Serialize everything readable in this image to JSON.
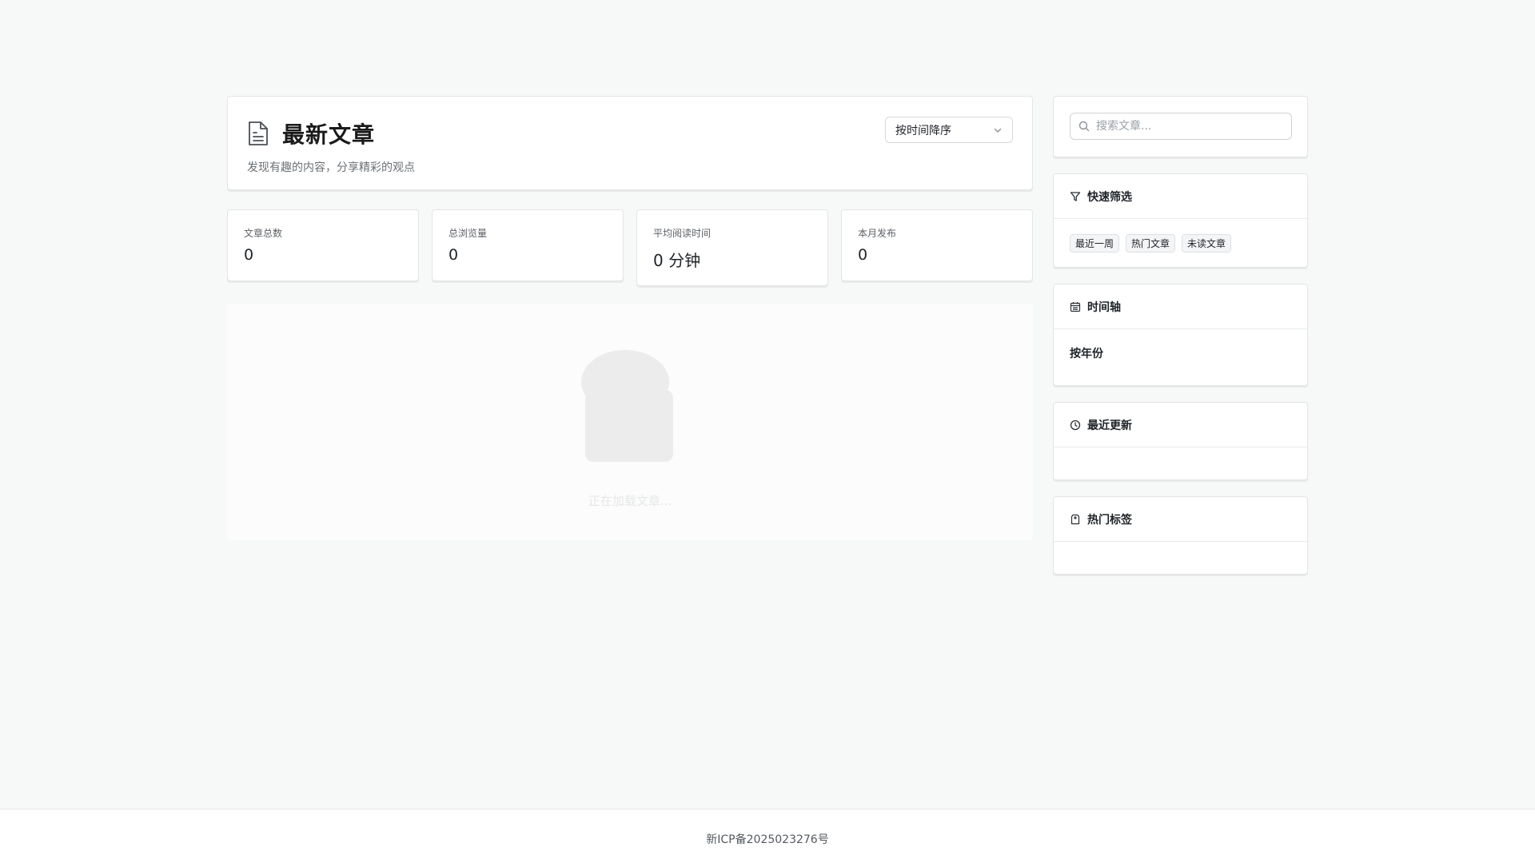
{
  "header": {
    "title": "最新文章",
    "subtitle": "发现有趣的内容，分享精彩的观点",
    "sort_selected": "按时间降序"
  },
  "stats": [
    {
      "label": "文章总数",
      "value": "0"
    },
    {
      "label": "总浏览量",
      "value": "0"
    },
    {
      "label": "平均阅读时间",
      "value": "0 分钟"
    },
    {
      "label": "本月发布",
      "value": "0"
    }
  ],
  "loading": {
    "text": "正在加载文章..."
  },
  "sidebar": {
    "search_placeholder": "搜索文章...",
    "quick_filter": {
      "title": "快速筛选",
      "chips": [
        "最近一周",
        "热门文章",
        "未读文章"
      ]
    },
    "timeline": {
      "title": "时间轴",
      "group_label": "按年份"
    },
    "recent": {
      "title": "最近更新"
    },
    "tags": {
      "title": "热门标签"
    }
  },
  "footer": {
    "icp": "新ICP备2025023276号"
  },
  "icons": [
    "document-icon",
    "chevron-down-icon",
    "search-icon",
    "filter-icon",
    "calendar-icon",
    "clock-icon",
    "tag-icon"
  ]
}
